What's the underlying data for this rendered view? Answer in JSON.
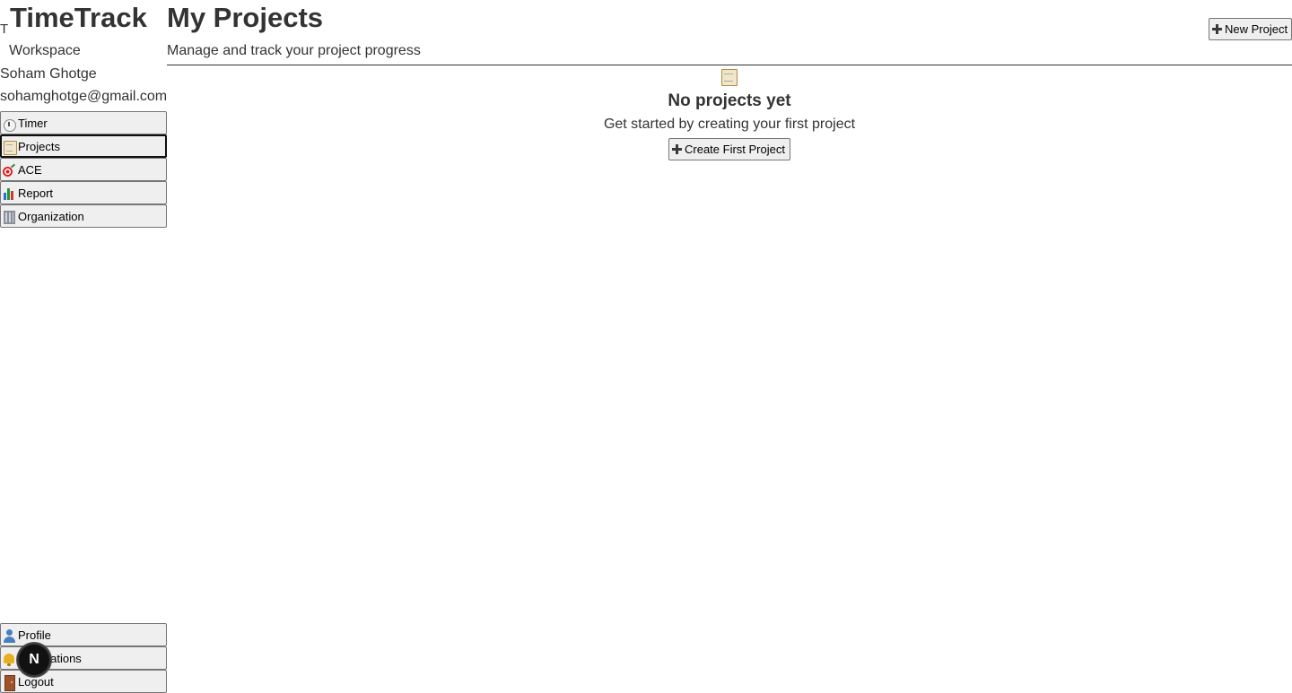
{
  "sidebar": {
    "logo_letter": "T",
    "brand": "TimeTrack",
    "subtitle": "Workspace",
    "user_name": "Soham Ghotge",
    "user_email": "sohamghotge@gmail.com",
    "nav": [
      {
        "label": "Timer",
        "icon": "stopwatch-icon"
      },
      {
        "label": "Projects",
        "icon": "clipboard-icon",
        "active": true
      },
      {
        "label": "ACE",
        "icon": "target-icon"
      },
      {
        "label": "Report",
        "icon": "bar-chart-icon"
      },
      {
        "label": "Organization",
        "icon": "building-icon"
      }
    ],
    "bottom_nav": [
      {
        "label": "Profile",
        "icon": "user-icon"
      },
      {
        "label": "Notifications",
        "icon": "bell-icon"
      },
      {
        "label": "Logout",
        "icon": "door-icon"
      }
    ],
    "avatar_letter": "N"
  },
  "main": {
    "title": "My Projects",
    "subtitle": "Manage and track your project progress",
    "new_project_label": "New Project",
    "empty_state": {
      "icon": "clipboard-icon",
      "title": "No projects yet",
      "text": "Get started by creating your first project",
      "button_label": "Create First Project"
    }
  }
}
